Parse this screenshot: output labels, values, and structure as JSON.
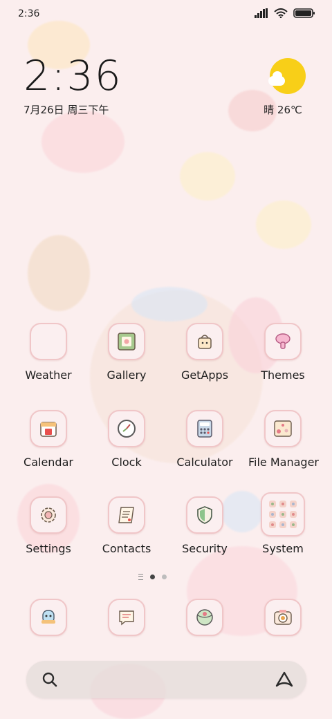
{
  "status_bar": {
    "time": "2:36",
    "icons": [
      "signal-icon",
      "wifi-icon",
      "battery-icon"
    ]
  },
  "clock_widget": {
    "time": "2:36",
    "date": "7月26日 周三下午"
  },
  "weather_widget": {
    "icon": "sun-cloud-icon",
    "text": "晴 26℃"
  },
  "apps": [
    {
      "label": "Weather"
    },
    {
      "label": "Gallery"
    },
    {
      "label": "GetApps"
    },
    {
      "label": "Themes"
    },
    {
      "label": "Calendar"
    },
    {
      "label": "Clock"
    },
    {
      "label": "Calculator"
    },
    {
      "label": "File Manager"
    },
    {
      "label": "Settings"
    },
    {
      "label": "Contacts"
    },
    {
      "label": "Security"
    },
    {
      "label": "System"
    }
  ],
  "dock": [
    {
      "icon": "pet-icon"
    },
    {
      "icon": "messages-icon"
    },
    {
      "icon": "browser-icon"
    },
    {
      "icon": "camera-icon"
    }
  ],
  "page_indicator": {
    "pages": 2,
    "active": 1
  },
  "search_bar": {
    "left_icon": "search-icon",
    "right_icon": "assistant-icon"
  },
  "colors": {
    "background": "#fbeeee",
    "tile_border": "#f0c6c8",
    "sun": "#f8cf18"
  }
}
